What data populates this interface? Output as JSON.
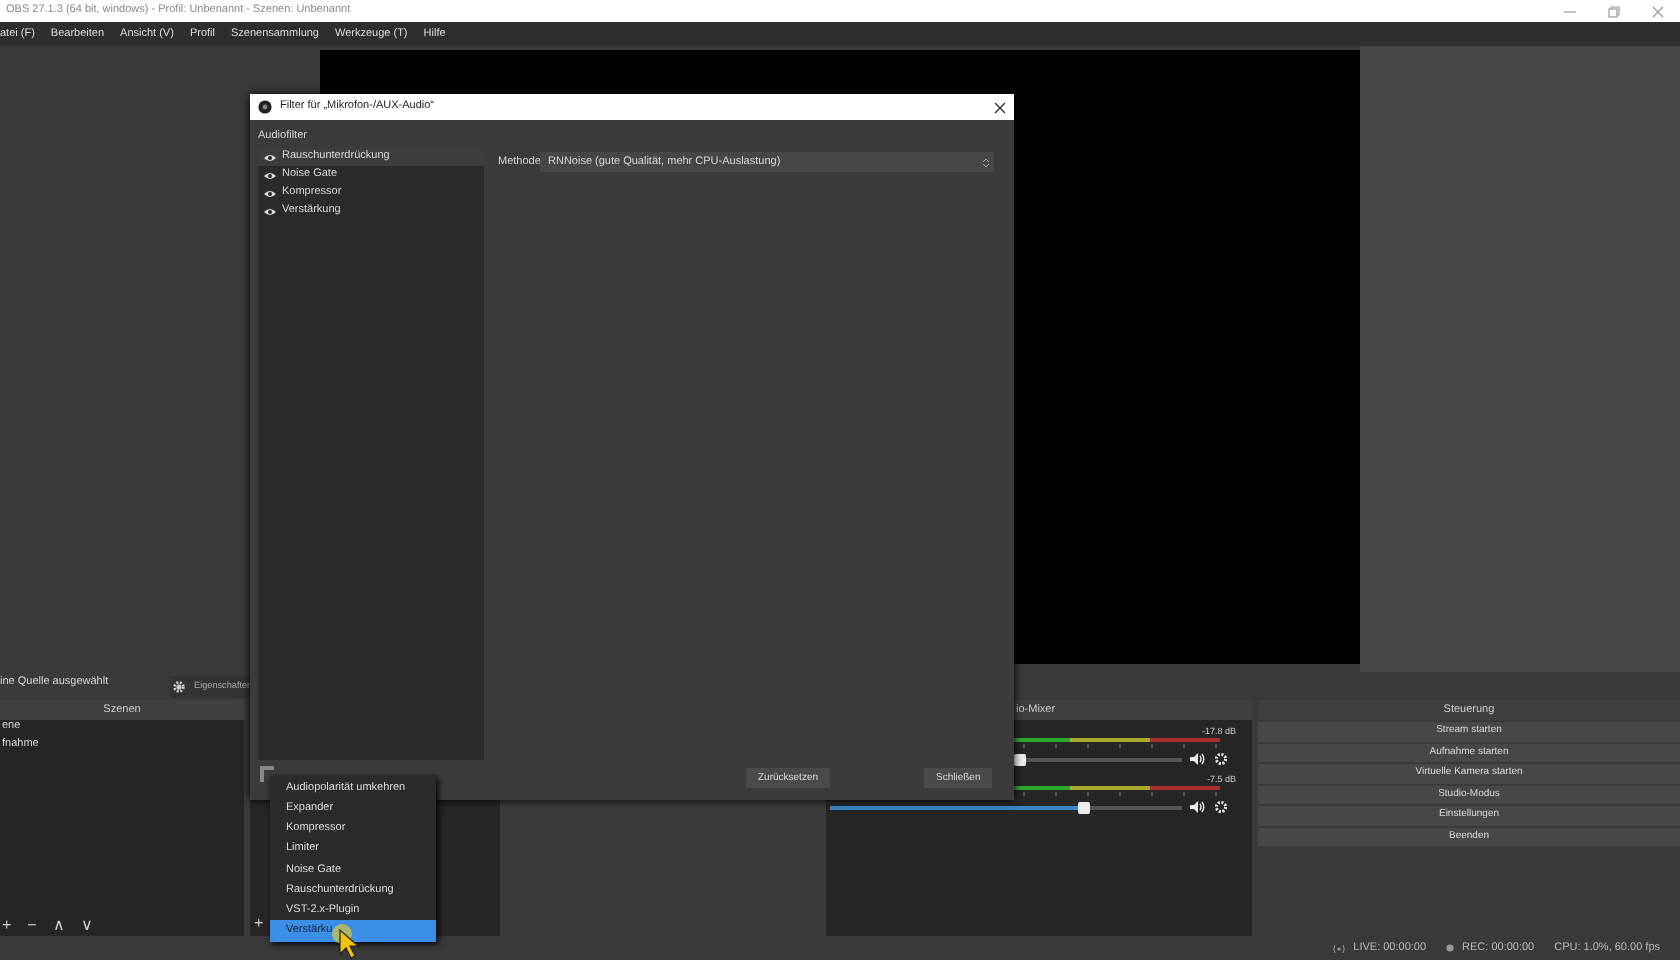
{
  "window": {
    "title": "OBS 27.1.3 (64 bit, windows) - Profil: Unbenannt - Szenen: Unbenannt"
  },
  "menu": [
    "atei (F)",
    "Bearbeiten",
    "Ansicht (V)",
    "Profil",
    "Szenensammlung",
    "Werkzeuge (T)",
    "Hilfe"
  ],
  "source_bar": {
    "label": "ine Quelle ausgewählt",
    "button": "Eigenschaften"
  },
  "scenes": {
    "title": "Szenen",
    "items": [
      {
        "label": "ene",
        "selected": false
      },
      {
        "label": "fnahme",
        "selected": false
      }
    ],
    "toolbar": [
      "+",
      "−",
      "∧",
      "∨"
    ]
  },
  "sources": {
    "toolbar": [
      "+"
    ]
  },
  "mixer": {
    "title": "io-Mixer",
    "channels": [
      {
        "reading": "-17.8 dB",
        "level": 0.54
      },
      {
        "reading": "-7.5 dB",
        "level": 0.72
      }
    ]
  },
  "controls": {
    "title": "Steuerung",
    "buttons": [
      "Stream starten",
      "Aufnahme starten",
      "Virtuelle Kamera starten",
      "Studio-Modus",
      "Einstellungen",
      "Beenden"
    ]
  },
  "status_bar": {
    "live": "LIVE: 00:00:00",
    "rec": "REC: 00:00:00",
    "cpu": "CPU: 1.0%, 60.00 fps"
  },
  "filter_dialog": {
    "title": "Filter für „Mikrofon-/AUX-Audio“",
    "section": "Audiofilter",
    "filters": [
      {
        "label": "Rauschunterdrückung",
        "selected": true,
        "visible": true
      },
      {
        "label": "Noise Gate",
        "selected": false,
        "visible": true
      },
      {
        "label": "Kompressor",
        "selected": false,
        "visible": true
      },
      {
        "label": "Verstärkung",
        "selected": false,
        "visible": true
      }
    ],
    "method_label": "Methode",
    "method_value": "RNNoise (gute Qualität, mehr CPU-Auslastung)",
    "buttons": [
      "Zurücksetzen",
      "Schließen"
    ]
  },
  "add_menu": {
    "items": [
      {
        "label": "Audiopolarität umkehren",
        "selected": false
      },
      {
        "label": "Expander",
        "selected": false
      },
      {
        "label": "Kompressor",
        "selected": false
      },
      {
        "label": "Limiter",
        "selected": false
      },
      {
        "label": "Noise Gate",
        "selected": false
      },
      {
        "label": "Rauschunterdrückung",
        "selected": false
      },
      {
        "label": "VST-2.x-Plugin",
        "selected": false
      },
      {
        "label": "Verstärku",
        "selected": true
      }
    ]
  }
}
